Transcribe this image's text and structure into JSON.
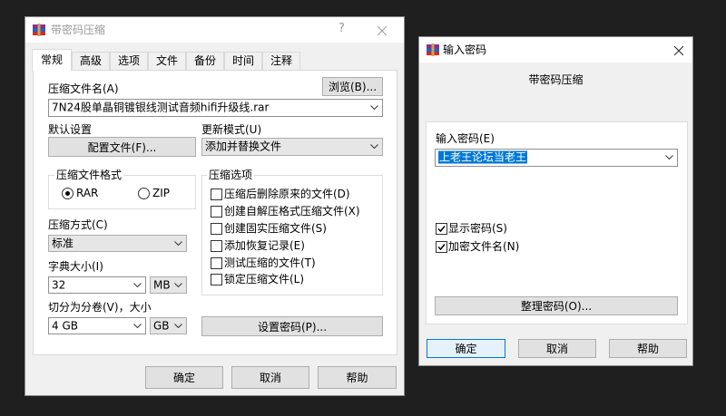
{
  "archive_dialog": {
    "title": "带密码压缩",
    "help_glyph": "?",
    "tabs": [
      {
        "label": "常规",
        "active": true
      },
      {
        "label": "高级",
        "active": false
      },
      {
        "label": "选项",
        "active": false
      },
      {
        "label": "文件",
        "active": false
      },
      {
        "label": "备份",
        "active": false
      },
      {
        "label": "时间",
        "active": false
      },
      {
        "label": "注释",
        "active": false
      }
    ],
    "general": {
      "archive_name_label": "压缩文件名(A)",
      "browse_button": "浏览(B)...",
      "archive_name": "7N24股单晶铜镀银线测试音频hifi升级线.rar",
      "default_settings_label": "默认设置",
      "profiles_button": "配置文件(F)...",
      "update_mode_label": "更新模式(U)",
      "update_mode": "添加并替换文件",
      "format_group": {
        "label": "压缩文件格式",
        "options": [
          {
            "label": "RAR",
            "selected": true
          },
          {
            "label": "ZIP",
            "selected": false
          }
        ]
      },
      "method_label": "压缩方式(C)",
      "method": "标准",
      "dictionary_label": "字典大小(I)",
      "dictionary_size": "32",
      "dictionary_unit": "MB",
      "split_label": "切分为分卷(V)，大小",
      "split_size": "4 GB",
      "split_unit": "GB",
      "options_group": {
        "label": "压缩选项",
        "options": [
          {
            "label": "压缩后删除原来的文件(D)",
            "checked": false
          },
          {
            "label": "创建自解压格式压缩文件(X)",
            "checked": false
          },
          {
            "label": "创建固实压缩文件(S)",
            "checked": false
          },
          {
            "label": "添加恢复记录(E)",
            "checked": false
          },
          {
            "label": "测试压缩的文件(T)",
            "checked": false
          },
          {
            "label": "锁定压缩文件(L)",
            "checked": false
          }
        ]
      },
      "set_password_button": "设置密码(P)..."
    },
    "buttons": {
      "ok": "确定",
      "cancel": "取消",
      "help": "帮助"
    }
  },
  "password_dialog": {
    "title": "输入密码",
    "subtitle": "带密码压缩",
    "password_label": "输入密码(E)",
    "password_value": "上老王论坛当老王",
    "show_password": {
      "label": "显示密码(S)",
      "checked": true
    },
    "encrypt_filenames": {
      "label": "加密文件名(N)",
      "checked": true
    },
    "organize_button": "整理密码(O)...",
    "buttons": {
      "ok": "确定",
      "cancel": "取消",
      "help": "帮助"
    }
  },
  "colors": {
    "desktop": "#1f1f1f",
    "selection": "#0078d7",
    "focus_border": "#0078d7"
  },
  "icons": {
    "app": "winrar-icon",
    "close": "close-icon",
    "dropdown": "chevron-down-icon",
    "check": "checkmark-icon"
  }
}
